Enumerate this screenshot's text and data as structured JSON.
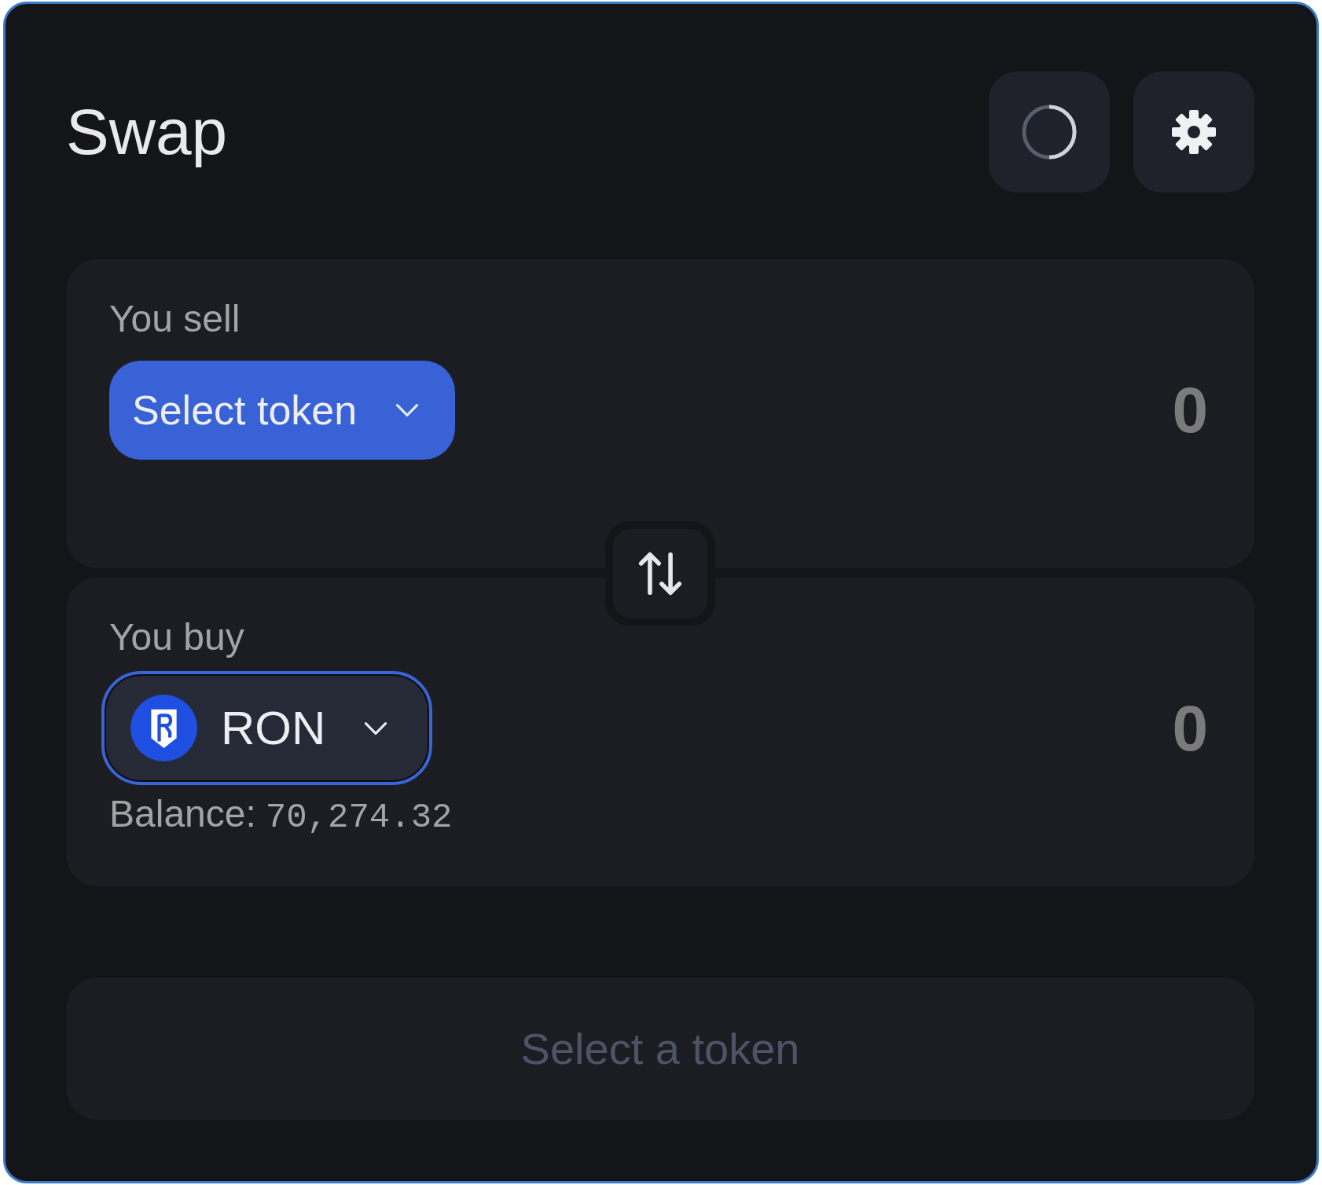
{
  "title": "Swap",
  "cards": [
    {
      "label": "You sell",
      "token": {
        "kind": "prompt",
        "label": "Select token"
      },
      "amount": {
        "placeholder": "0"
      }
    },
    {
      "label": "You buy",
      "token": {
        "kind": "chosen",
        "label": "RON",
        "focused": true
      },
      "amount": {
        "placeholder": "0"
      },
      "balance": {
        "label": "Balance:",
        "value": "70,274.32"
      }
    }
  ],
  "action_button": {
    "label": "Select a token",
    "disabled": true
  }
}
